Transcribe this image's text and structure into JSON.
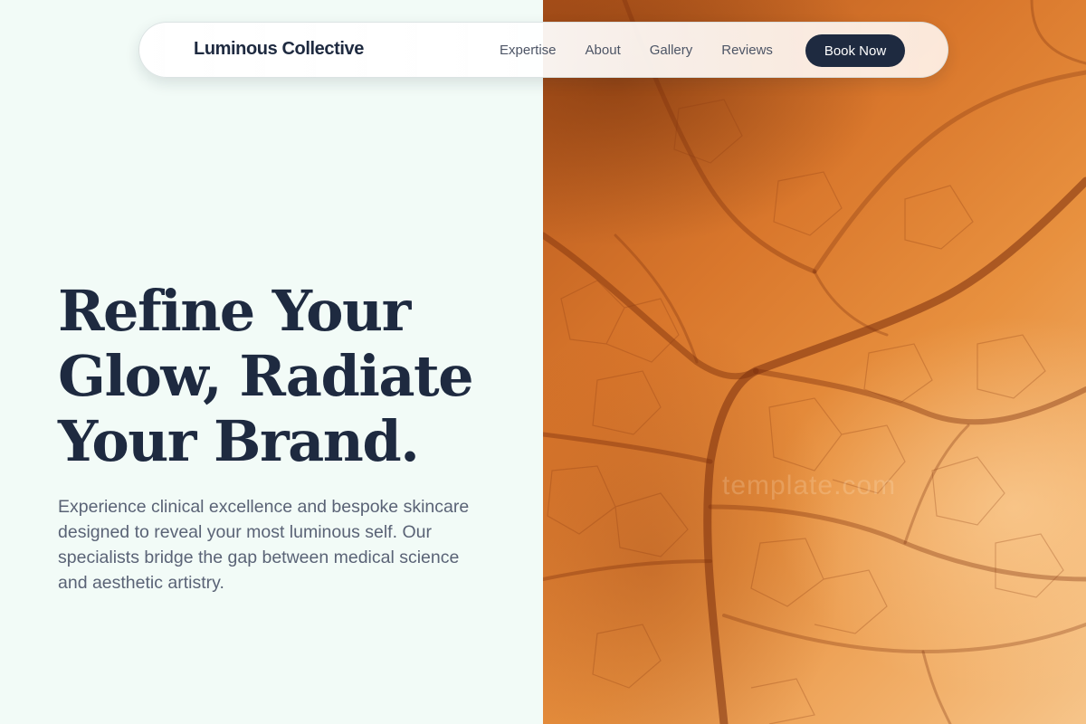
{
  "brand": {
    "name": "Luminous Collective"
  },
  "nav": {
    "links": [
      "Expertise",
      "About",
      "Gallery",
      "Reviews"
    ],
    "cta_label": "Book Now"
  },
  "hero": {
    "headline_lines": [
      "Refine Your",
      "Glow, Radiate",
      "Your Brand."
    ],
    "subtext": "Experience clinical excellence and bespoke skincare designed to reveal your most luminous self. Our specialists bridge the gap between medical science and aesthetic artistry.",
    "image_watermark": "template.com"
  },
  "colors": {
    "background": "#f2fbf7",
    "navy": "#1e2a40",
    "muted_text": "#5a6376",
    "image_orange": "#e8913f"
  }
}
